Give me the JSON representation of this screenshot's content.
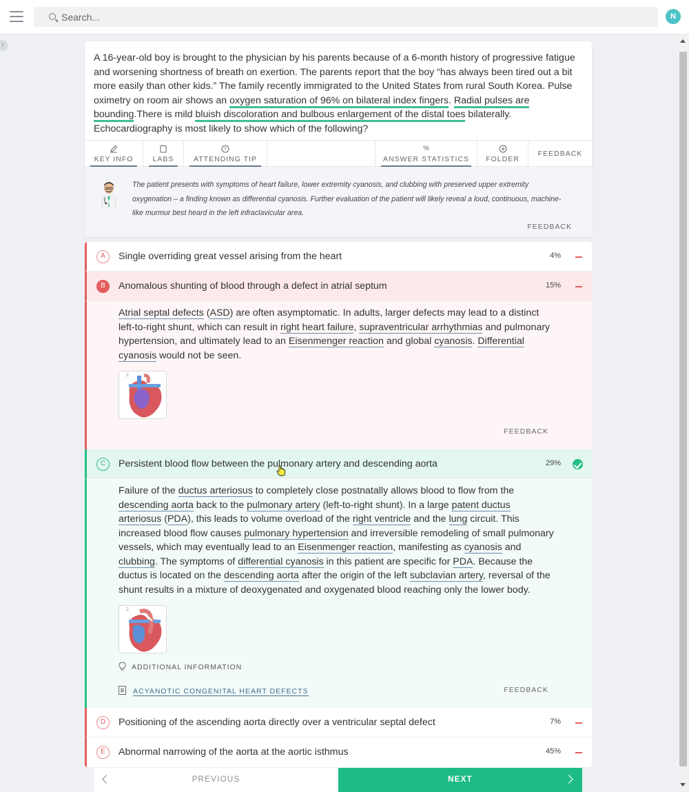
{
  "header": {
    "search_placeholder": "Search...",
    "avatar_initial": "N"
  },
  "question": {
    "stem": [
      {
        "t": "A 16-year-old boy is brought to the physician by his parents because of a 6-month history of progressive fatigue and worsening shortness of breath on exertion. The parents report that the boy “has always been tired out a bit more easily than other kids.” The family recently immigrated to the United States from rural South Korea. Pulse oximetry on room air shows an "
      },
      {
        "t": "oxygen saturation of 96% on bilateral index fingers",
        "hl": true
      },
      {
        "t": ". "
      },
      {
        "t": "Radial pulses are bounding",
        "hl": true
      },
      {
        "t": ".There is mild "
      },
      {
        "t": "bluish discoloration and bulbous enlargement of the distal toes",
        "hl": true
      },
      {
        "t": " bilaterally. Echocardiography is most likely to show which of the following?"
      }
    ]
  },
  "tabs": {
    "key_info": "KEY INFO",
    "labs": "LABS",
    "attending_tip": "ATTENDING TIP",
    "answer_statistics": "ANSWER STATISTICS",
    "folder": "FOLDER",
    "feedback": "FEEDBACK"
  },
  "tip": {
    "text": "The patient presents with symptoms of heart failure, lower extremity cyanosis, and clubbing with preserved upper extremity oxygenation – a finding known as differential cyanosis. Further evaluation of the patient will likely reveal a loud, continuous, machine-like murmur best heard in the left infraclavicular area.",
    "feedback": "FEEDBACK"
  },
  "answers": [
    {
      "letter": "A",
      "text": "Single overriding great vessel arising from the heart",
      "pct": "4%"
    },
    {
      "letter": "B",
      "text": "Anomalous shunting of blood through a defect in atrial septum",
      "pct": "15%"
    },
    {
      "letter": "C",
      "text": "Persistent blood flow between the pulmonary artery and descending aorta",
      "pct": "29%"
    },
    {
      "letter": "D",
      "text": "Positioning of the ascending aorta directly over a ventricular septal defect",
      "pct": "7%"
    },
    {
      "letter": "E",
      "text": "Abnormal narrowing of the aorta at the aortic isthmus",
      "pct": "45%"
    }
  ],
  "explanation_b": {
    "paragraph": [
      {
        "t": "Atrial septal defects",
        "u": true
      },
      {
        "t": " ("
      },
      {
        "t": "ASD",
        "u": true
      },
      {
        "t": ") are often asymptomatic. In adults, larger defects may lead to a distinct left-to-right shunt, which can result in "
      },
      {
        "t": "right heart failure",
        "u": true
      },
      {
        "t": ", "
      },
      {
        "t": "supraventricular arrhythmias",
        "u": true
      },
      {
        "t": " and pulmonary hypertension, and ultimately lead to an "
      },
      {
        "t": "Eisenmenger reaction",
        "u": true
      },
      {
        "t": " and global "
      },
      {
        "t": "cyanosis",
        "u": true
      },
      {
        "t": ". "
      },
      {
        "t": "Differential cyanosis",
        "u": true
      },
      {
        "t": " would not be seen."
      }
    ],
    "image_number": "2",
    "feedback": "FEEDBACK"
  },
  "explanation_c": {
    "paragraph": [
      {
        "t": "Failure of the "
      },
      {
        "t": "ductus arteriosus",
        "u": true
      },
      {
        "t": " to completely close postnatally allows blood to flow from the "
      },
      {
        "t": "descending aorta",
        "u": true
      },
      {
        "t": " back to the "
      },
      {
        "t": "pulmonary artery",
        "u": true
      },
      {
        "t": " (left-to-right shunt). In a large "
      },
      {
        "t": "patent ductus arteriosus",
        "u": true
      },
      {
        "t": " ("
      },
      {
        "t": "PDA",
        "u": true
      },
      {
        "t": "), this leads to volume overload of the "
      },
      {
        "t": "right ventricle",
        "u": true
      },
      {
        "t": " and the "
      },
      {
        "t": "lung",
        "u": true
      },
      {
        "t": " circuit. This increased blood flow causes "
      },
      {
        "t": "pulmonary hypertension",
        "u": true
      },
      {
        "t": " and irreversible remodeling of small pulmonary vessels, which may eventually lead to an "
      },
      {
        "t": "Eisenmenger reaction",
        "u": true
      },
      {
        "t": ", manifesting as "
      },
      {
        "t": "cyanosis",
        "u": true
      },
      {
        "t": " and "
      },
      {
        "t": "clubbing",
        "u": true
      },
      {
        "t": ". The symptoms of "
      },
      {
        "t": "differential cyanosis",
        "u": true
      },
      {
        "t": " in this patient are specific for "
      },
      {
        "t": "PDA",
        "u": true
      },
      {
        "t": ". Because the ductus is located on the "
      },
      {
        "t": "descending aorta",
        "u": true
      },
      {
        "t": " after the origin of the left "
      },
      {
        "t": "subclavian artery",
        "u": true
      },
      {
        "t": ", reversal of the shunt results in a mixture of deoxygenated and oxygenated blood reaching only the lower body."
      }
    ],
    "image_number": "2",
    "additional_info": "ADDITIONAL INFORMATION",
    "article": "ACYANOTIC CONGENITAL HEART DEFECTS",
    "feedback": "FEEDBACK"
  },
  "nav": {
    "previous": "PREVIOUS",
    "next": "NEXT"
  },
  "colors": {
    "accent_green": "#1fbb86",
    "wrong_red": "#e35d5d",
    "highlight_green": "#3cc08e"
  }
}
